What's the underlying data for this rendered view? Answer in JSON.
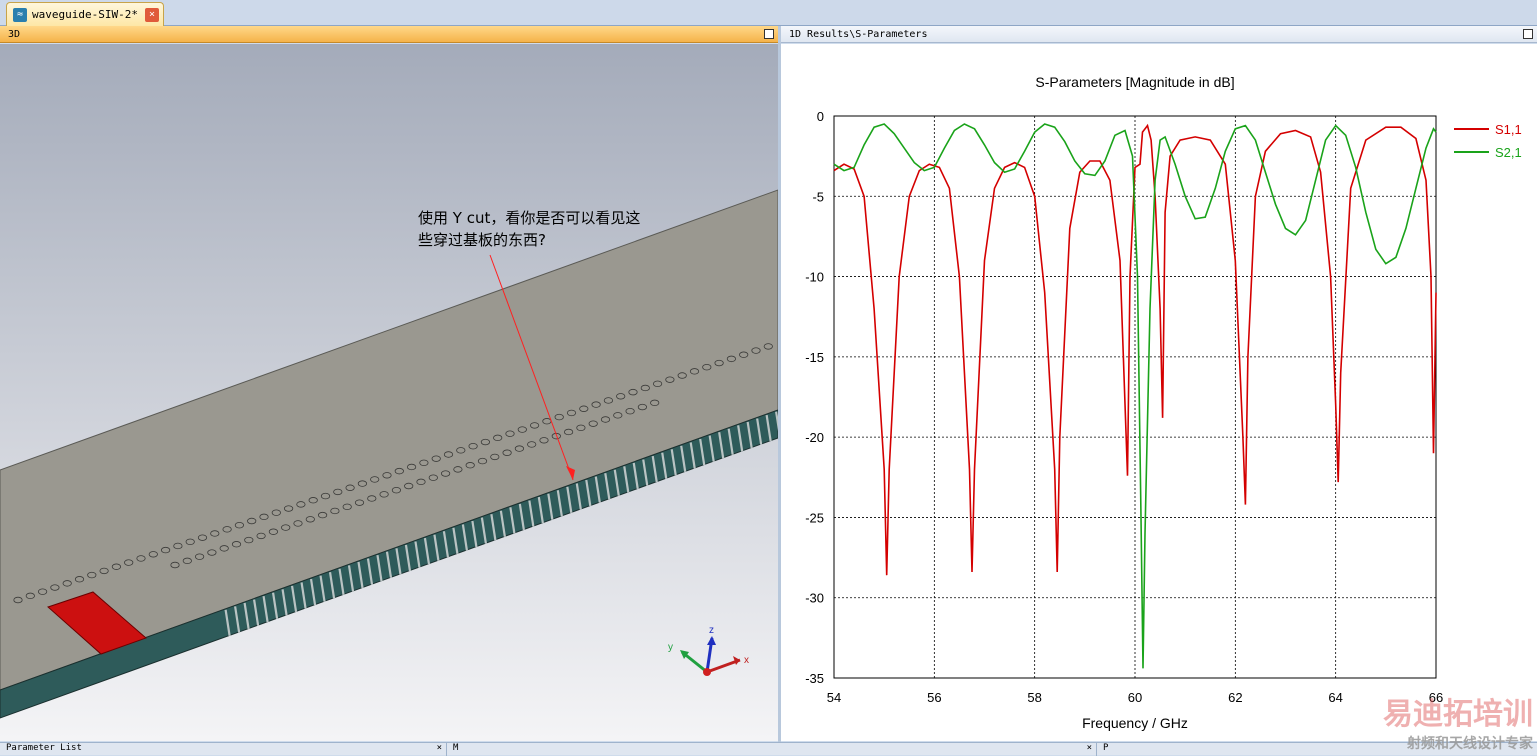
{
  "document_tab": {
    "label": "waveguide-SIW-2*"
  },
  "panels": {
    "left_title": "3D",
    "right_title": "1D Results\\S-Parameters"
  },
  "annotation": {
    "line1": "使用 Y cut，看你是否可以看见这",
    "line2": "些穿过基板的东西?"
  },
  "axes_widget": {
    "x": "x",
    "y": "y",
    "z": "z"
  },
  "bottom_bar": {
    "seg1": "Parameter List",
    "seg2": "M",
    "seg3": "P"
  },
  "watermark": {
    "line1": "易迪拓培训",
    "line2": "射频和天线设计专家"
  },
  "colors": {
    "s11": "#d40000",
    "s21": "#1aa31a",
    "active_tab": "#f5b34a",
    "via_body": "#2e5b5a"
  },
  "chart_data": {
    "type": "line",
    "title": "S-Parameters [Magnitude in dB]",
    "xlabel": "Frequency / GHz",
    "ylabel": "",
    "xlim": [
      54,
      66
    ],
    "ylim": [
      -35,
      0
    ],
    "xticks": [
      54,
      56,
      58,
      60,
      62,
      64,
      66
    ],
    "yticks": [
      0,
      -5,
      -10,
      -15,
      -20,
      -25,
      -30,
      -35
    ],
    "grid": true,
    "legend_position": "right",
    "series": [
      {
        "name": "S1,1",
        "points": [
          [
            54.0,
            -3.4
          ],
          [
            54.2,
            -3.0
          ],
          [
            54.4,
            -3.3
          ],
          [
            54.6,
            -5
          ],
          [
            54.8,
            -12
          ],
          [
            55.0,
            -22
          ],
          [
            55.05,
            -28.6
          ],
          [
            55.1,
            -22
          ],
          [
            55.3,
            -10
          ],
          [
            55.5,
            -5
          ],
          [
            55.7,
            -3.4
          ],
          [
            55.9,
            -3.0
          ],
          [
            56.1,
            -3.2
          ],
          [
            56.3,
            -4.5
          ],
          [
            56.5,
            -10
          ],
          [
            56.7,
            -22
          ],
          [
            56.75,
            -28.4
          ],
          [
            56.8,
            -22
          ],
          [
            57.0,
            -9
          ],
          [
            57.2,
            -4.5
          ],
          [
            57.4,
            -3.2
          ],
          [
            57.6,
            -2.9
          ],
          [
            57.8,
            -3.2
          ],
          [
            58.0,
            -5
          ],
          [
            58.2,
            -11
          ],
          [
            58.4,
            -22
          ],
          [
            58.45,
            -28.4
          ],
          [
            58.5,
            -20
          ],
          [
            58.7,
            -7
          ],
          [
            58.9,
            -3.5
          ],
          [
            59.1,
            -2.8
          ],
          [
            59.3,
            -2.8
          ],
          [
            59.5,
            -4
          ],
          [
            59.7,
            -9
          ],
          [
            59.85,
            -22.4
          ],
          [
            59.9,
            -10
          ],
          [
            60.0,
            -3.2
          ],
          [
            60.1,
            -3.0
          ],
          [
            60.15,
            -1.0
          ],
          [
            60.25,
            -0.6
          ],
          [
            60.32,
            -1.5
          ],
          [
            60.4,
            -5
          ],
          [
            60.5,
            -12
          ],
          [
            60.55,
            -18.8
          ],
          [
            60.6,
            -6
          ],
          [
            60.7,
            -2.5
          ],
          [
            60.9,
            -1.5
          ],
          [
            61.2,
            -1.3
          ],
          [
            61.5,
            -1.5
          ],
          [
            61.8,
            -3
          ],
          [
            62.0,
            -9
          ],
          [
            62.15,
            -20
          ],
          [
            62.2,
            -24.2
          ],
          [
            62.25,
            -15
          ],
          [
            62.4,
            -5
          ],
          [
            62.6,
            -2.2
          ],
          [
            62.9,
            -1.1
          ],
          [
            63.2,
            -0.9
          ],
          [
            63.5,
            -1.3
          ],
          [
            63.7,
            -3.5
          ],
          [
            63.9,
            -10
          ],
          [
            64.0,
            -18
          ],
          [
            64.05,
            -22.8
          ],
          [
            64.1,
            -16
          ],
          [
            64.3,
            -4.5
          ],
          [
            64.6,
            -1.5
          ],
          [
            65.0,
            -0.7
          ],
          [
            65.3,
            -0.7
          ],
          [
            65.6,
            -1.4
          ],
          [
            65.8,
            -4
          ],
          [
            65.9,
            -10
          ],
          [
            65.95,
            -21
          ],
          [
            66.0,
            -11
          ]
        ]
      },
      {
        "name": "S2,1",
        "points": [
          [
            54.0,
            -3.0
          ],
          [
            54.2,
            -3.4
          ],
          [
            54.4,
            -3.2
          ],
          [
            54.6,
            -1.8
          ],
          [
            54.8,
            -0.7
          ],
          [
            55.0,
            -0.5
          ],
          [
            55.2,
            -1.1
          ],
          [
            55.4,
            -2.0
          ],
          [
            55.6,
            -2.9
          ],
          [
            55.8,
            -3.4
          ],
          [
            56.0,
            -3.2
          ],
          [
            56.2,
            -2.0
          ],
          [
            56.4,
            -0.9
          ],
          [
            56.6,
            -0.5
          ],
          [
            56.8,
            -0.8
          ],
          [
            57.0,
            -1.8
          ],
          [
            57.2,
            -2.9
          ],
          [
            57.4,
            -3.5
          ],
          [
            57.6,
            -3.3
          ],
          [
            57.8,
            -2.2
          ],
          [
            58.0,
            -1.0
          ],
          [
            58.2,
            -0.5
          ],
          [
            58.4,
            -0.7
          ],
          [
            58.6,
            -1.6
          ],
          [
            58.8,
            -2.8
          ],
          [
            59.0,
            -3.6
          ],
          [
            59.2,
            -3.7
          ],
          [
            59.4,
            -2.8
          ],
          [
            59.6,
            -1.2
          ],
          [
            59.8,
            -0.9
          ],
          [
            59.95,
            -2.5
          ],
          [
            60.05,
            -10
          ],
          [
            60.12,
            -25
          ],
          [
            60.16,
            -34.4
          ],
          [
            60.2,
            -26
          ],
          [
            60.3,
            -12
          ],
          [
            60.4,
            -4
          ],
          [
            60.5,
            -1.5
          ],
          [
            60.6,
            -1.3
          ],
          [
            60.8,
            -3
          ],
          [
            61.0,
            -5
          ],
          [
            61.2,
            -6.4
          ],
          [
            61.4,
            -6.3
          ],
          [
            61.6,
            -4.5
          ],
          [
            61.8,
            -2.2
          ],
          [
            62.0,
            -0.8
          ],
          [
            62.2,
            -0.6
          ],
          [
            62.4,
            -1.5
          ],
          [
            62.6,
            -3.5
          ],
          [
            62.8,
            -5.5
          ],
          [
            63.0,
            -7.0
          ],
          [
            63.2,
            -7.4
          ],
          [
            63.4,
            -6.5
          ],
          [
            63.6,
            -4.0
          ],
          [
            63.8,
            -1.5
          ],
          [
            64.0,
            -0.6
          ],
          [
            64.2,
            -1.2
          ],
          [
            64.4,
            -3.2
          ],
          [
            64.6,
            -6
          ],
          [
            64.8,
            -8.3
          ],
          [
            65.0,
            -9.2
          ],
          [
            65.2,
            -8.8
          ],
          [
            65.4,
            -7.0
          ],
          [
            65.6,
            -4.5
          ],
          [
            65.8,
            -2.0
          ],
          [
            65.95,
            -0.8
          ],
          [
            66.0,
            -1.0
          ]
        ]
      }
    ]
  }
}
